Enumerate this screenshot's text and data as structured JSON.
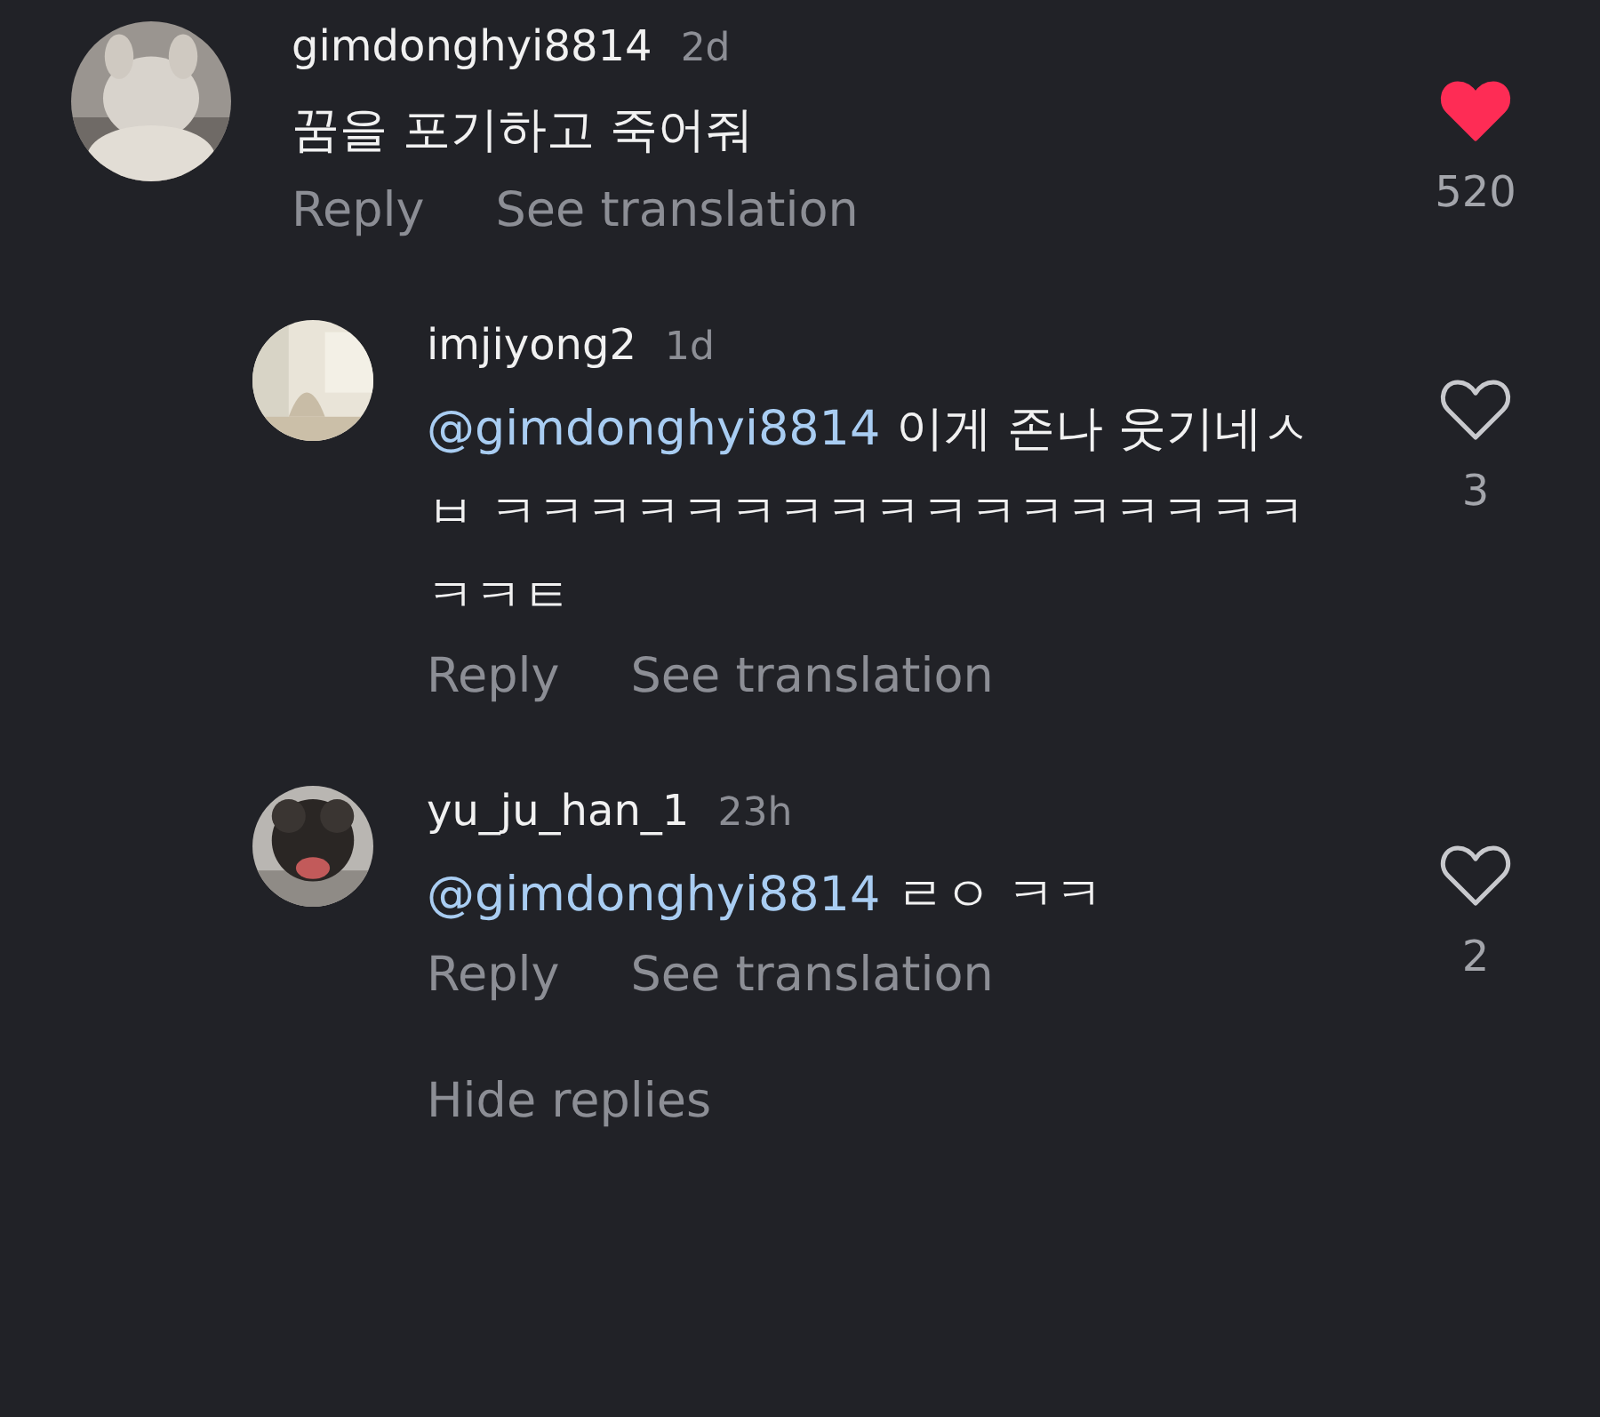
{
  "comments": [
    {
      "username": "gimdonghyi8814",
      "time": "2d",
      "text": "꿈을 포기하고 죽어줘",
      "actions": [
        "Reply",
        "See translation"
      ],
      "liked": true,
      "likes": "520",
      "replies": [
        {
          "username": "imjiyong2",
          "time": "1d",
          "mention": "@gimdonghyi8814",
          "text": "이게 존나 웃기네ㅅㅂ ㅋㅋㅋㅋㅋㅋㅋㅋㅋㅋㅋㅋㅋㅋㅋㅋㅋㅋㅋㅌ",
          "actions": [
            "Reply",
            "See translation"
          ],
          "liked": false,
          "likes": "3"
        },
        {
          "username": "yu_ju_han_1",
          "time": "23h",
          "mention": "@gimdonghyi8814",
          "text": "ㄹㅇ ㅋㅋ",
          "actions": [
            "Reply",
            "See translation"
          ],
          "liked": false,
          "likes": "2"
        }
      ],
      "hide_replies": "Hide replies"
    }
  ]
}
